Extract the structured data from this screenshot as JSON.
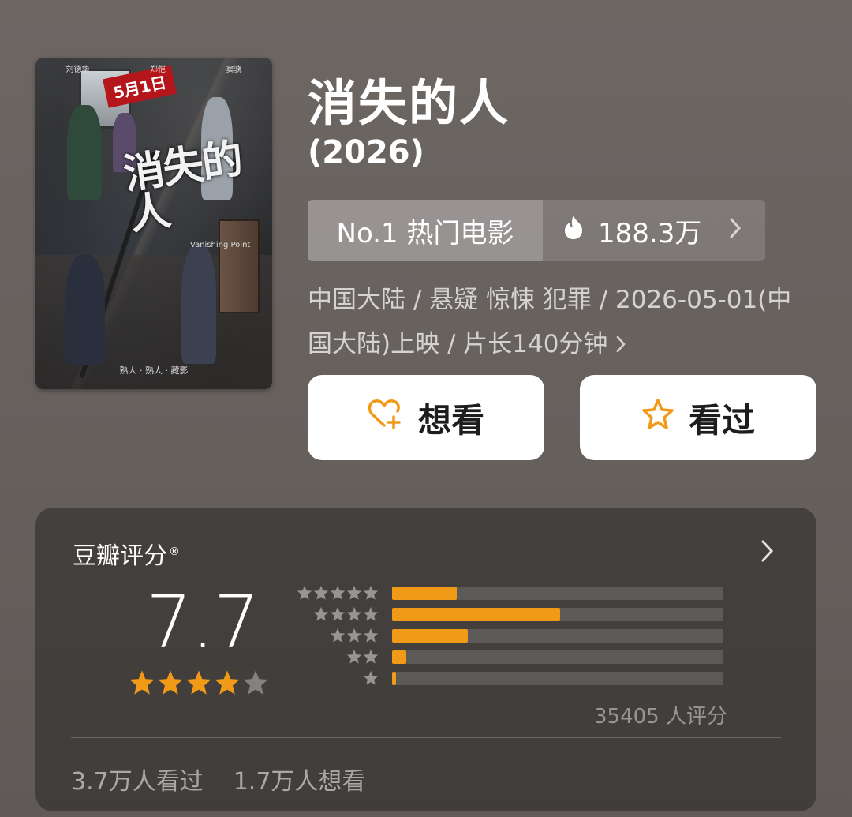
{
  "movie": {
    "title": "消失的人",
    "year": "(2026)",
    "poster": {
      "date_stamp": "5月1日",
      "calligraphy_title": "消失的人",
      "cast_top": [
        "刘德华",
        "郑恺",
        "窦骁"
      ],
      "english_title": "Vanishing Point",
      "bottom_slogan": "熟人 · 熟人 · 藏影"
    }
  },
  "rank": {
    "label": "No.1 热门电影",
    "heat": "188.3万"
  },
  "meta": {
    "line1": "中国大陆 / 悬疑 惊悚 犯罪 / 2026-05-01(中",
    "line2": "国大陆)上映 / 片长140分钟"
  },
  "actions": {
    "want_label": "想看",
    "seen_label": "看过"
  },
  "rating": {
    "title": "豆瓣评分",
    "registered_mark": "®",
    "score": "7.7",
    "stars_filled": 4,
    "stars_total": 5,
    "distribution": [
      {
        "stars": 5,
        "fraction": 0.195
      },
      {
        "stars": 4,
        "fraction": 0.508
      },
      {
        "stars": 3,
        "fraction": 0.228
      },
      {
        "stars": 2,
        "fraction": 0.042
      },
      {
        "stars": 1,
        "fraction": 0.012
      }
    ],
    "count_text": "35405 人评分",
    "watched_text": "3.7万人看过",
    "want_text": "1.7万人想看"
  },
  "colors": {
    "accent": "#f19a17",
    "background": "#66605d",
    "card": "#3d3a38"
  }
}
